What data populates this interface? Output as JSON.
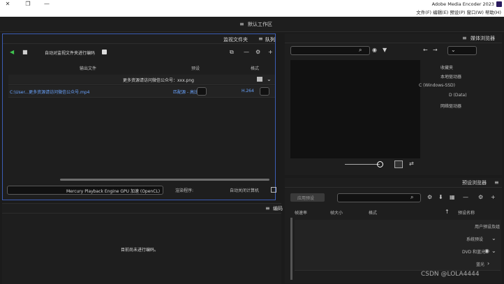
{
  "app": {
    "title": "Adobe Media Encoder 2023",
    "menu": "文件(F)  编辑(E)  预设(P)  窗口(W)  帮助(H)",
    "workspace": "默认工作区"
  },
  "queue": {
    "tabs": [
      "队列",
      "监视文件夹"
    ],
    "auto_encode_label": "自动对监视文件夹进行编码",
    "columns": [
      "格式",
      "预设",
      "输出文件"
    ],
    "group_title": "更多资源请访问微信公众号：xxx.png",
    "item": {
      "format": "H.264",
      "preset": "匹配源 - 高比特率",
      "output": "C:\\User...更多资源请访问微信公众号.mp4"
    },
    "auto_shutdown_label": "自动关闭计算机",
    "renderer_label": "渲染程序:",
    "renderer_value": "Mercury Playback Engine GPU 加速 (OpenCL)"
  },
  "encoding": {
    "title": "编码",
    "empty_message": "目前尚未进行编码。"
  },
  "media_browser": {
    "title": "媒体浏览器",
    "tree": [
      {
        "label": "收藏夹",
        "indent": 0
      },
      {
        "label": "本地驱动器",
        "indent": 0
      },
      {
        "label": "C (Windows-SSD)",
        "indent": 1
      },
      {
        "label": "D (Data)",
        "indent": 1
      },
      {
        "label": "网络驱动器",
        "indent": 0
      }
    ]
  },
  "preset_browser": {
    "title": "预设浏览器",
    "apply_button": "应用预设",
    "columns": [
      "预设名称",
      "格式",
      "帧大小",
      "帧速率"
    ],
    "rows": [
      {
        "label": "用户预设及组"
      },
      {
        "label": "系统预设"
      },
      {
        "label": "DVD 和蓝光"
      },
      {
        "label": "蓝光"
      }
    ]
  },
  "watermark": "CSDN @LOLA4444",
  "colors": {
    "accent": "#3b5db5",
    "green": "#3fc34f",
    "link": "#6aa4ff"
  }
}
